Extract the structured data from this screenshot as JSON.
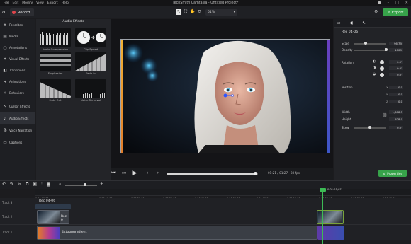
{
  "menu": {
    "items": [
      "File",
      "Edit",
      "Modify",
      "View",
      "Export",
      "Help"
    ],
    "window_title": "TechSmith Camtasia - Untitled Project*"
  },
  "toolbar": {
    "record_label": "Record",
    "zoom_value": "51%",
    "export_label": "Export"
  },
  "sidebar": {
    "items": [
      {
        "label": "Favorites",
        "icon": "star-icon"
      },
      {
        "label": "Media",
        "icon": "media-icon"
      },
      {
        "label": "Annotations",
        "icon": "annotation-icon"
      },
      {
        "label": "Visual Effects",
        "icon": "visual-effects-icon"
      },
      {
        "label": "Transitions",
        "icon": "transitions-icon"
      },
      {
        "label": "Animations",
        "icon": "animations-icon"
      },
      {
        "label": "Behaviors",
        "icon": "behaviors-icon"
      },
      {
        "label": "Cursor Effects",
        "icon": "cursor-icon"
      },
      {
        "label": "Audio Effects",
        "icon": "audio-icon"
      },
      {
        "label": "Voice Narration",
        "icon": "mic-icon"
      },
      {
        "label": "Captions",
        "icon": "captions-icon"
      }
    ]
  },
  "audio_panel": {
    "title": "Audio Effects",
    "effects": [
      "Audio Compression",
      "Clip Speed",
      "Emphasize",
      "Fade in",
      "Fade Out",
      "Noise Removal"
    ]
  },
  "playback": {
    "current_time": "01:21",
    "total_time": "01:27",
    "fps": "30 fps",
    "progress": 0.97
  },
  "properties": {
    "clip_name": "Rec 04-06",
    "scale_label": "Scale",
    "scale_value": "96.7%",
    "scale_level": 0.35,
    "opacity_label": "Opacity",
    "opacity_value": "100%",
    "opacity_level": 1.0,
    "rotation_label": "Rotation",
    "rotation_z": "0.0°",
    "rotation_y": "0.0°",
    "rotation_x": "0.0°",
    "position_label": "Position",
    "position_x": "0.0",
    "position_y": "0.0",
    "position_z": "0.0",
    "width_label": "Width",
    "width_value": "1,608.5",
    "height_label": "Height",
    "height_value": "928.0",
    "skew_label": "Skew",
    "skew_value": "0.0°",
    "properties_button": "Properties"
  },
  "timeline": {
    "ticks": [
      "0:00:00;00",
      "0:00:10;00",
      "0:00:20;00",
      "0:00:30;00",
      "0:00:40;00",
      "0:00:50;00",
      "0:01:00;00",
      "0:01:10;00",
      "0:01:20;00",
      "0:01:30;00",
      "0:01:40;00"
    ],
    "playhead_time": "0:01:21;07",
    "tracks": [
      {
        "label": "Track 3",
        "clip": "Rec 04-06"
      },
      {
        "label": "Track 2",
        "clip": "Rec 0"
      },
      {
        "label": "Track 1",
        "clip": "4ktoppgradient"
      }
    ]
  },
  "colors": {
    "accent_green": "#37a34a",
    "record_red": "#e0454b",
    "playhead_green": "#3dbb55"
  }
}
